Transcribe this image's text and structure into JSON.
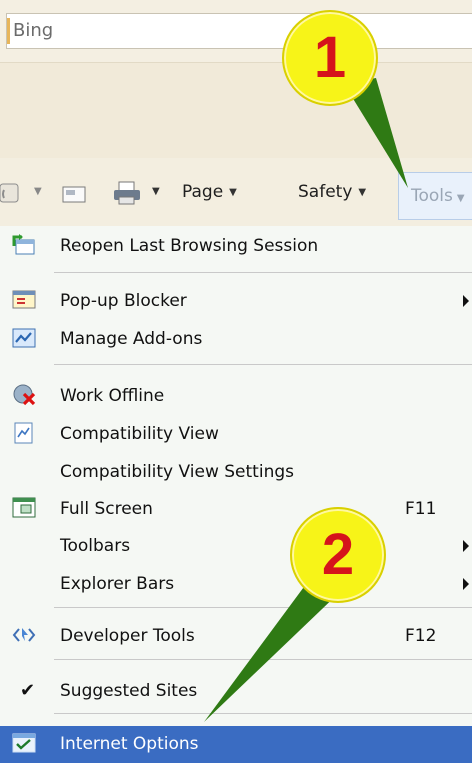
{
  "search": {
    "value": "Bing"
  },
  "toolbar": {
    "page_label": "Page",
    "safety_label": "Safety",
    "tools_label": "Tools"
  },
  "menu": {
    "items": [
      {
        "label": "Reopen Last Browsing Session",
        "icon": "reopen-session-icon"
      },
      {
        "label": "Pop-up Blocker",
        "icon": "popup-blocker-icon",
        "submenu": true
      },
      {
        "label": "Manage Add-ons",
        "icon": "addons-icon"
      },
      {
        "label": "Work Offline",
        "icon": "work-offline-icon"
      },
      {
        "label": "Compatibility View",
        "icon": "compatibility-view-icon"
      },
      {
        "label": "Compatibility View Settings"
      },
      {
        "label": "Full Screen",
        "icon": "full-screen-icon",
        "shortcut": "F11"
      },
      {
        "label": "Toolbars",
        "submenu": true
      },
      {
        "label": "Explorer Bars",
        "submenu": true
      },
      {
        "label": "Developer Tools",
        "icon": "developer-tools-icon",
        "shortcut": "F12"
      },
      {
        "label": "Suggested Sites",
        "checked": true
      },
      {
        "label": "Internet Options",
        "icon": "internet-options-icon",
        "highlighted": true
      }
    ]
  },
  "callouts": {
    "first": "1",
    "second": "2"
  },
  "colors": {
    "callout": "#f7f418",
    "callout_text": "#d5141b",
    "pointer": "#2f7a14",
    "highlight": "#3a6cc2"
  }
}
